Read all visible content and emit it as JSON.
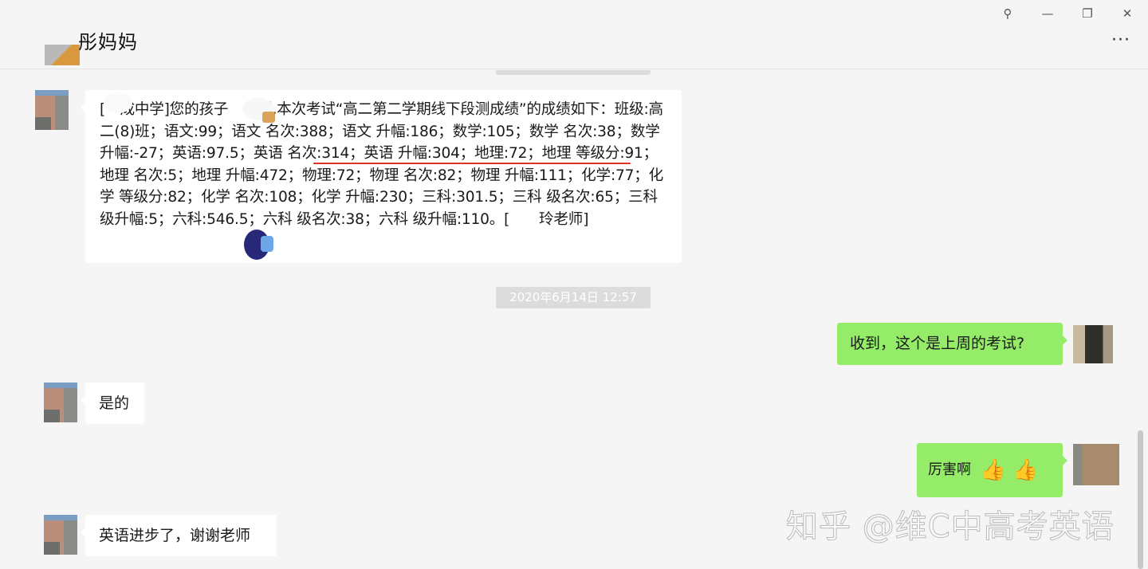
{
  "window_controls": {
    "pin": "⚲",
    "minimize": "—",
    "maximize": "❐",
    "close": "✕"
  },
  "header": {
    "title": "彤妈妈",
    "more": "···"
  },
  "messages": [
    {
      "side": "left",
      "text": "[　成中学]您的孩子　　彤,本次考试“高二第二学期线下段测成绩”的成绩如下：班级:高二(8)班；语文:99；语文 名次:388；语文 升幅:186；数学:105；数学 名次:38；数学 升幅:-27；英语:97.5；英语 名次:314；英语 升幅:304；地理:72；地理 等级分:91；地理 名次:5；地理 升幅:472；物理:72；物理 名次:82；物理 升幅:111；化学:77；化学 等级分:82；化学 名次:108；化学 升幅:230；三科:301.5；三科 级名次:65；三科 级升幅:5；六科:546.5；六科 级名次:38；六科 级升幅:110。[　　玲老师]"
    },
    {
      "side": "right",
      "text": "收到，这个是上周的考试?"
    },
    {
      "side": "left",
      "text": "是的"
    },
    {
      "side": "right",
      "text": "厉害啊",
      "emoji": "👍 👍"
    },
    {
      "side": "left",
      "text": "英语进步了，谢谢老师"
    }
  ],
  "timestamp": "2020年6月14日 12:57",
  "watermark": "知乎 @维C中高考英语",
  "colors": {
    "sent_bubble": "#95ec69",
    "received_bubble": "#ffffff",
    "underline": "#e2312d"
  }
}
